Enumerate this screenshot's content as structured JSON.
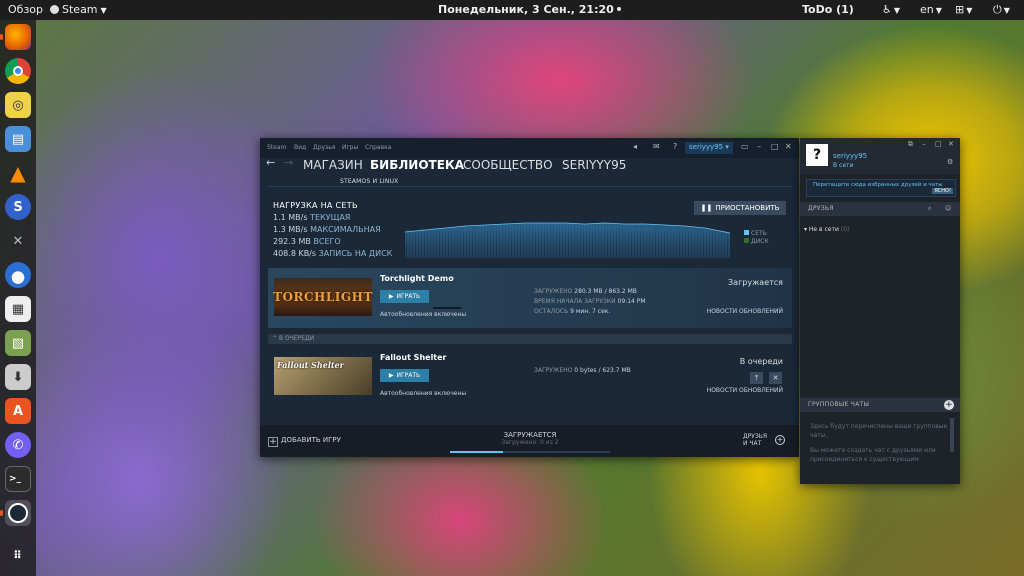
{
  "topbar": {
    "activities": "Обзор",
    "app_name": "Steam",
    "clock": "Понедельник, 3 Сен., 21:20",
    "todo": "ToDo (1)",
    "lang": "en"
  },
  "dock": {
    "items": [
      "firefox-icon",
      "chromium-icon",
      "rhythmbox-icon",
      "files-icon",
      "vlc-icon",
      "simplenote-icon",
      "tools-icon",
      "thunderbird-icon",
      "calculator-icon",
      "image-viewer-icon",
      "installer-icon",
      "software-center-icon",
      "viber-icon",
      "terminal-icon",
      "steam-icon",
      "app-grid-icon"
    ]
  },
  "steam": {
    "menu": [
      "Steam",
      "Вид",
      "Друзья",
      "Игры",
      "Справка"
    ],
    "username": "seriyyy95",
    "help_icon": "?",
    "nav": {
      "store": "МАГАЗИН",
      "library": "БИБЛИОТЕКА",
      "community": "СООБЩЕСТВО",
      "profile": "SERIYYY95"
    },
    "subtab": "STEAMOS И LINUX",
    "network": {
      "header": "НАГРУЗКА НА СЕТЬ",
      "current_val": "1.1 MB/s",
      "current_lbl": "ТЕКУЩАЯ",
      "max_val": "1.3 MB/s",
      "max_lbl": "МАКСИМАЛЬНАЯ",
      "total_val": "292.3 MB",
      "total_lbl": "ВСЕГО",
      "disk_val": "408.8 KB/s",
      "disk_lbl": "ЗАПИСЬ НА ДИСК",
      "pause": "ПРИОСТАНОВИТЬ",
      "legend_net": "СЕТЬ",
      "legend_disk": "ДИСК"
    },
    "downloads": [
      {
        "title": "Torchlight Demo",
        "thumb_text": "TORCHLIGHT",
        "play": "ИГРАТЬ",
        "auto": "Автообновления включены",
        "l1": "ЗАГРУЖЕНО",
        "v1": "280.3 MB / 863.2 MB",
        "l2": "ВРЕМЯ НАЧАЛА ЗАГРУЗКИ",
        "v2": "09:14 PM",
        "l3": "ОСТАЛОСЬ",
        "v3": "9 мин. 7 сек.",
        "state": "Загружается",
        "news": "НОВОСТИ ОБНОВЛЕНИЙ"
      }
    ],
    "queue_header": "В ОЧЕРЕДИ",
    "queued": [
      {
        "title": "Fallout Shelter",
        "thumb_text": "Fallout Shelter",
        "play": "ИГРАТЬ",
        "auto": "Автообновления включены",
        "l1": "ЗАГРУЖЕНО",
        "v1": "0 bytes / 623.7 MB",
        "state": "В очереди",
        "news": "НОВОСТИ ОБНОВЛЕНИЙ"
      }
    ],
    "bottom": {
      "add_game": "ДОБАВИТЬ ИГРУ",
      "downloading": "ЗАГРУЖАЕТСЯ",
      "downloaded": "Загружено: 0 из 2",
      "friends_l1": "ДРУЗЬЯ",
      "friends_l2": "И ЧАТ",
      "progress": 0.33
    }
  },
  "friends": {
    "avatar": "?",
    "name": "seriyyy95",
    "status": "В сети",
    "notice": "Перетащите сюда избранных друзей и чаты",
    "notice_ok": "ЯСНО!",
    "section": "ДРУЗЬЯ",
    "online_label": "Не в сети",
    "online_count": "(0)",
    "group_header": "ГРУППОВЫЕ ЧАТЫ",
    "group_text1": "Здесь будут перечислены ваши групповые чаты.",
    "group_text2": "Вы можете создать чат с друзьями или присоединиться к существующим"
  },
  "colors": {
    "steam_bg": "#1b2838",
    "accent_blue": "#67c1f5",
    "play_green_blue": "#2e7fa6"
  }
}
